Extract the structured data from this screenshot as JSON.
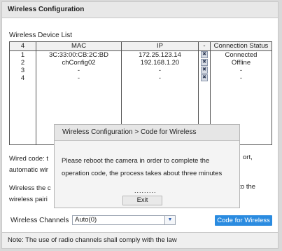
{
  "window": {
    "title": "Wireless Configuration"
  },
  "device_list": {
    "label": "Wireless Device List",
    "columns": [
      "4",
      "MAC",
      "IP",
      "-",
      "Connection Status"
    ],
    "rows": [
      {
        "index": "1",
        "mac": "3C:33:00:CB:2C:BD",
        "ip": "172.25.123.14",
        "status": "Connected"
      },
      {
        "index": "2",
        "mac": "chConfig02",
        "ip": "192.168.1.20",
        "status": "Offline"
      },
      {
        "index": "3",
        "mac": "-",
        "ip": "-",
        "status": "-"
      },
      {
        "index": "4",
        "mac": "-",
        "ip": "-",
        "status": "-"
      }
    ],
    "delete_glyph": "✖"
  },
  "info": {
    "line1_left": "Wired code: t",
    "line1_right": "ort,",
    "line2_left": "automatic wir",
    "line3_left": "Wireless the c",
    "line3_right": "nto the",
    "line4_left": "wireless pairi"
  },
  "channels": {
    "label": "Wireless Channels",
    "value": "Auto(0)",
    "arrow": "▼"
  },
  "code_button": "Code for Wireless",
  "note": "Note: The use of radio channels shall comply with the law",
  "dialog": {
    "title": "Wireless Configuration > Code for Wireless",
    "line1": "Please reboot the camera in order to complete the",
    "line2": "operation code, the process takes about three minutes",
    "progress": ".........",
    "exit": "Exit"
  }
}
